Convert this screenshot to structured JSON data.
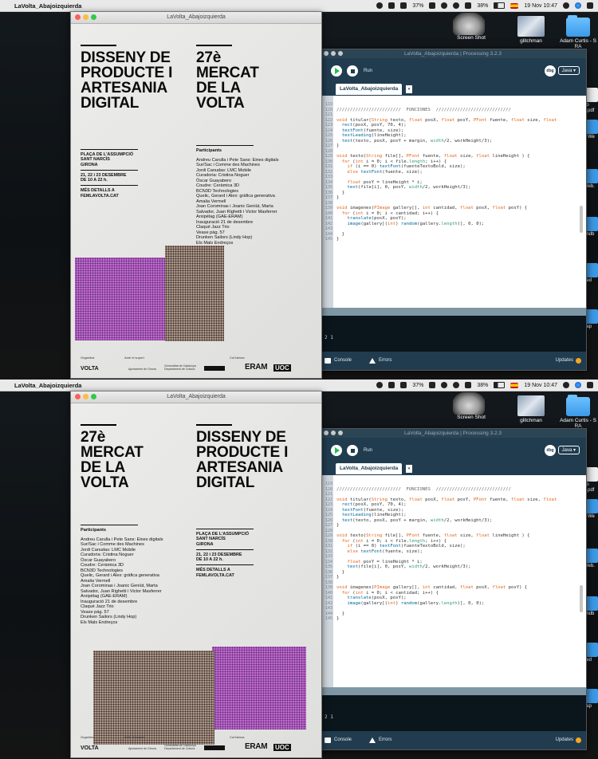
{
  "menubar": {
    "app_name": "LaVolta_Abajoizquierda",
    "battery_left": "37%",
    "battery_right": "38%",
    "clock": "19 Nov 10:47"
  },
  "desktop": {
    "items": [
      {
        "label": "Screen Shot",
        "kind": "thumb"
      },
      {
        "label": "glitchman",
        "kind": "thumb"
      },
      {
        "label": "Adam Curtis - S\nRA",
        "kind": "folder"
      }
    ],
    "side_fragments": [
      "go\n2.pdf",
      "o We",
      "Web.",
      "andb",
      "ped",
      "aap"
    ]
  },
  "poster_window": {
    "title": "LaVolta_Abajoizquierda"
  },
  "poster": {
    "title_a": [
      "DISSENY DE",
      "PRODUCTE I",
      "ARTESANIA",
      "DIGITAL"
    ],
    "title_b": [
      "27è",
      "MERCAT",
      "DE LA",
      "VOLTA"
    ],
    "venue": [
      "PLAÇA DE L'ASSUMPCIÓ",
      "SANT NARCÍS",
      "GIRONA"
    ],
    "dates": [
      "21, 22 i 23 DESEMBRE",
      "DE 10 A 22 h."
    ],
    "more": [
      "MÉS DETALLS A",
      "FEMLAVOLTA.CAT"
    ],
    "participants_heading": "Participants",
    "participants": [
      "Andreu Carulla i Pete Sans: Eines digitals",
      "Sur/Sac i Comme des Machines",
      "Jordi Canudas: LMC Mobile",
      "Curadoria: Cristina Noguer",
      "Òscar Guayabero",
      "Coudre: Ceràmica 3D",
      "BCN3D Technologies",
      "Quelic, Gerard i Alex: gràfica generativa",
      "Amalia Vermell",
      "Joan Corominas i Joanic Geniüt, Marta",
      "Salvador, Juan Righetti i Victor Masferrer",
      "Arxipèlag (GAE-ERAM)",
      "Inauguració 21 de desembre",
      "Claqué Jazz Trio",
      "Vease pág. 57",
      "Drunken Sailors (Lindy Hop)",
      "Els Mals Endreços"
    ],
    "footer": {
      "organitza": "Organitza",
      "suport": "Amb el suport",
      "col": "Col·labora",
      "volta": "VOLTA",
      "ajuntament": "Ajuntament de Girona",
      "generalitat": "Generalitat de Catalunya Departament de Cultura",
      "eram": "ERAM",
      "uoc": "UOC"
    }
  },
  "processing": {
    "window_title": "LaVolta_Abajoizquierda | Processing 3.2.3",
    "run_label": "Run",
    "mode_label": "Java ▾",
    "debug_label": "dbg",
    "tab_label": "LaVolta_Abajoizquierda",
    "tab_menu": "▾",
    "line_numbers": [
      "119",
      "120",
      "121",
      "122",
      "123",
      "124",
      "125",
      "126",
      "127",
      "128",
      "129",
      "130",
      "131",
      "132",
      "133",
      "134",
      "135",
      "136",
      "137",
      "138",
      "139",
      "140",
      "141",
      "142",
      "143",
      "144",
      "145"
    ],
    "code_lines": [
      "",
      "////////////////////////  FUNCIONES  ////////////////////////////",
      "",
      "void titular(String texto, float posX, float posY, PFont fuente, float size, float",
      "  rect(posX, posY, 70, 4);",
      "  textFont(fuente, size);",
      "  textLeading(lineHeight);",
      "  text(texto, posX, posY + margin, width/2, workHeight/3);",
      "}",
      "",
      "void texto(String file[], PFont fuente, float size, float lineHeight ) {",
      "  for (int i = 0; i < file.length; i++) {",
      "    if (i == 0) textFont(fuenteTextoBold, size);",
      "    else textFont(fuente, size);",
      "",
      "    float posY = lineHeight * i;",
      "    text(file[i], 0, posY, width/2, workHeight/3);",
      "  }",
      "}",
      "",
      "void imagenes(PImage gallery[], int cantidad, float posX, float posY) {",
      "  for (int i = 0; i < cantidad; i++) {",
      "    translate(posX, posY);",
      "    image(gallery[(int) random(gallery.length)], 0, 0);",
      "",
      "  }",
      "}"
    ],
    "console_text": "2 1",
    "console_tab": "Console",
    "errors_tab": "Errors",
    "updates_label": "Updates"
  }
}
